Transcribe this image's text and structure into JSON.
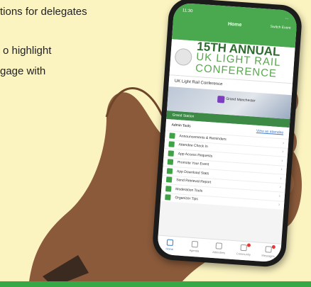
{
  "background_text": [
    "tions for delegates",
    "o highlight",
    "gage with"
  ],
  "phone": {
    "status": {
      "time": "11:30",
      "signal": "..."
    },
    "header": {
      "title": "Home",
      "switch_label": "Switch Event"
    },
    "banner": {
      "line1": "15TH ANNUAL",
      "line2": "UK LIGHT RAIL",
      "line3": "CONFERENCE"
    },
    "conference_name": "UK Light Rail Conference",
    "map_label": "Grand Manchester",
    "grand_station": "Grand Station",
    "admin": {
      "title": "Admin Tools",
      "link": "View as attendee"
    },
    "menu_items": [
      {
        "label": "Announcements & Reminders"
      },
      {
        "label": "Attendee Check In"
      },
      {
        "label": "App Access Requests"
      },
      {
        "label": "Promote Your Event"
      },
      {
        "label": "App Download Stats"
      },
      {
        "label": "Send Retrieval Report"
      },
      {
        "label": "Moderation Tools"
      },
      {
        "label": "Organizer Tips"
      }
    ],
    "tabs": [
      {
        "label": "Home"
      },
      {
        "label": "Agenda"
      },
      {
        "label": "Attendees"
      },
      {
        "label": "Community"
      },
      {
        "label": "Messages"
      }
    ]
  },
  "colors": {
    "accent": "#4aa84e",
    "background": "#fbf3c0",
    "link": "#3c78c8"
  }
}
